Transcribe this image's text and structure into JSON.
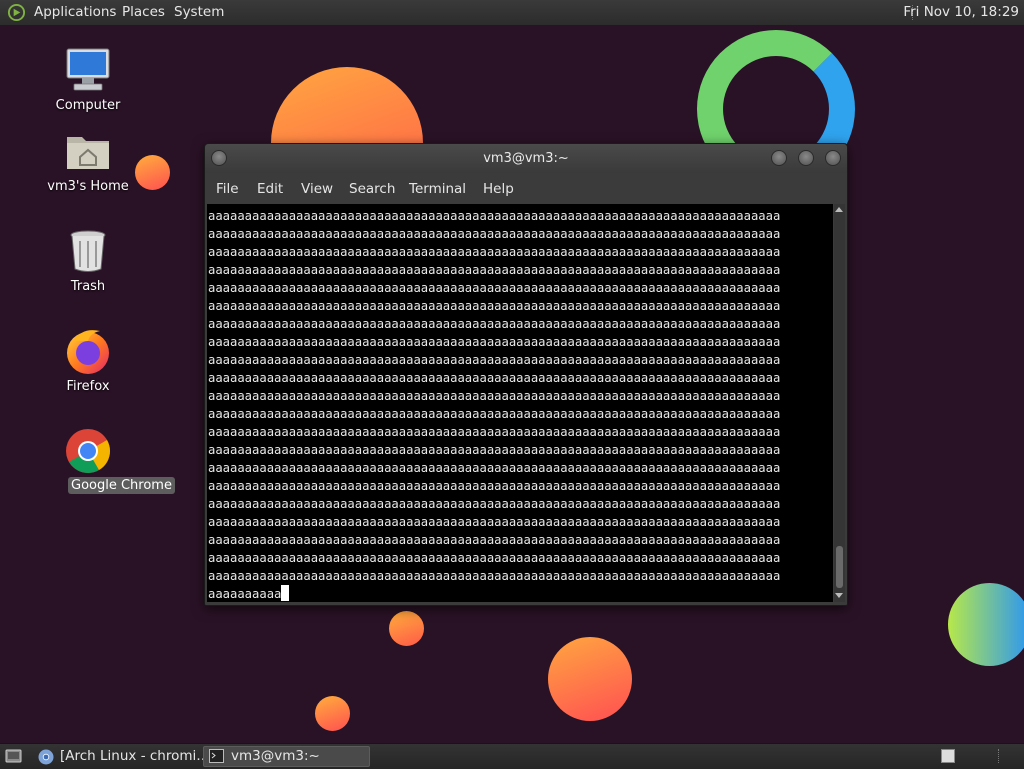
{
  "top_panel": {
    "menus": [
      "Applications",
      "Places",
      "System"
    ],
    "clock": "Fri Nov 10, 18:29"
  },
  "desktop_icons": [
    {
      "label": "Computer",
      "icon": "computer-icon"
    },
    {
      "label": "vm3's Home",
      "icon": "home-folder-icon"
    },
    {
      "label": "Trash",
      "icon": "trash-icon"
    },
    {
      "label": "Firefox",
      "icon": "firefox-icon"
    },
    {
      "label": "Google Chrome",
      "icon": "chrome-icon",
      "selected": true
    }
  ],
  "terminal": {
    "title": "vm3@vm3:~",
    "menus": [
      "File",
      "Edit",
      "View",
      "Search",
      "Terminal",
      "Help"
    ],
    "line_text": "aaaaaaaaaaaaaaaaaaaaaaaaaaaaaaaaaaaaaaaaaaaaaaaaaaaaaaaaaaaaaaaaaaaaaaaaaaaaaaaaaaaaaaaaaaaaaaaaaaaaaaaaaaaaaaaaaaaaaaaaaaaaaaaaaaaaaaaaaaaa",
    "lines": [
      "aaaaaaaaaaaaaaaaaaaaaaaaaaaaaaaaaaaaaaaaaaaaaaaaaaaaaaaaaaaaaaaaaaaaaaaaaaaaaa",
      "aaaaaaaaaaaaaaaaaaaaaaaaaaaaaaaaaaaaaaaaaaaaaaaaaaaaaaaaaaaaaaaaaaaaaaaaaaaaaa",
      "aaaaaaaaaaaaaaaaaaaaaaaaaaaaaaaaaaaaaaaaaaaaaaaaaaaaaaaaaaaaaaaaaaaaaaaaaaaaaa",
      "aaaaaaaaaaaaaaaaaaaaaaaaaaaaaaaaaaaaaaaaaaaaaaaaaaaaaaaaaaaaaaaaaaaaaaaaaaaaaa",
      "aaaaaaaaaaaaaaaaaaaaaaaaaaaaaaaaaaaaaaaaaaaaaaaaaaaaaaaaaaaaaaaaaaaaaaaaaaaaaa",
      "aaaaaaaaaaaaaaaaaaaaaaaaaaaaaaaaaaaaaaaaaaaaaaaaaaaaaaaaaaaaaaaaaaaaaaaaaaaaaa",
      "aaaaaaaaaaaaaaaaaaaaaaaaaaaaaaaaaaaaaaaaaaaaaaaaaaaaaaaaaaaaaaaaaaaaaaaaaaaaaa",
      "aaaaaaaaaaaaaaaaaaaaaaaaaaaaaaaaaaaaaaaaaaaaaaaaaaaaaaaaaaaaaaaaaaaaaaaaaaaaaa",
      "aaaaaaaaaaaaaaaaaaaaaaaaaaaaaaaaaaaaaaaaaaaaaaaaaaaaaaaaaaaaaaaaaaaaaaaaaaaaaa",
      "aaaaaaaaaaaaaaaaaaaaaaaaaaaaaaaaaaaaaaaaaaaaaaaaaaaaaaaaaaaaaaaaaaaaaaaaaaaaaa",
      "aaaaaaaaaaaaaaaaaaaaaaaaaaaaaaaaaaaaaaaaaaaaaaaaaaaaaaaaaaaaaaaaaaaaaaaaaaaaaa",
      "aaaaaaaaaaaaaaaaaaaaaaaaaaaaaaaaaaaaaaaaaaaaaaaaaaaaaaaaaaaaaaaaaaaaaaaaaaaaaa",
      "aaaaaaaaaaaaaaaaaaaaaaaaaaaaaaaaaaaaaaaaaaaaaaaaaaaaaaaaaaaaaaaaaaaaaaaaaaaaaa",
      "aaaaaaaaaaaaaaaaaaaaaaaaaaaaaaaaaaaaaaaaaaaaaaaaaaaaaaaaaaaaaaaaaaaaaaaaaaaaaa",
      "aaaaaaaaaaaaaaaaaaaaaaaaaaaaaaaaaaaaaaaaaaaaaaaaaaaaaaaaaaaaaaaaaaaaaaaaaaaaaa",
      "aaaaaaaaaaaaaaaaaaaaaaaaaaaaaaaaaaaaaaaaaaaaaaaaaaaaaaaaaaaaaaaaaaaaaaaaaaaaaa",
      "aaaaaaaaaaaaaaaaaaaaaaaaaaaaaaaaaaaaaaaaaaaaaaaaaaaaaaaaaaaaaaaaaaaaaaaaaaaaaa",
      "aaaaaaaaaaaaaaaaaaaaaaaaaaaaaaaaaaaaaaaaaaaaaaaaaaaaaaaaaaaaaaaaaaaaaaaaaaaaaa",
      "aaaaaaaaaaaaaaaaaaaaaaaaaaaaaaaaaaaaaaaaaaaaaaaaaaaaaaaaaaaaaaaaaaaaaaaaaaaaaa",
      "aaaaaaaaaaaaaaaaaaaaaaaaaaaaaaaaaaaaaaaaaaaaaaaaaaaaaaaaaaaaaaaaaaaaaaaaaaaaaa",
      "aaaaaaaaaaaaaaaaaaaaaaaaaaaaaaaaaaaaaaaaaaaaaaaaaaaaaaaaaaaaaaaaaaaaaaaaaaaaaa"
    ],
    "prompt_line": "aaaaaaaaaa"
  },
  "taskbar": {
    "tasks": [
      {
        "label": "[Arch Linux - chromi…",
        "icon": "chromium-icon"
      },
      {
        "label": "vm3@vm3:~",
        "icon": "terminal-icon",
        "active": true
      }
    ]
  },
  "colors": {
    "desktop_bg": "#2a1226",
    "panel_bg": "#2f2f2f",
    "terminal_bg": "#000000",
    "terminal_fg": "#e8e8e8",
    "selection_bg": "#5d5d5d"
  }
}
